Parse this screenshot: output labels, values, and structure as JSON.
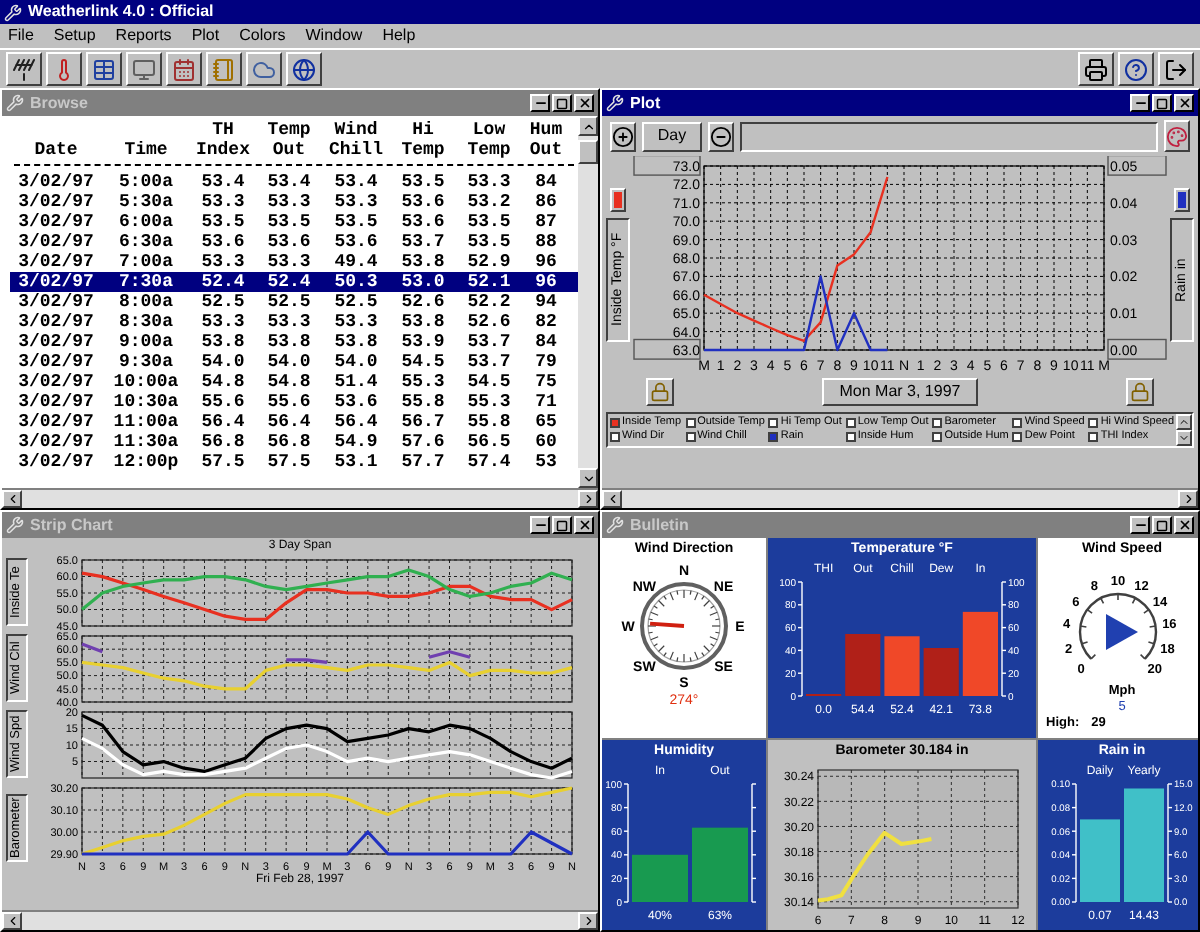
{
  "app": {
    "title": "Weatherlink 4.0 : Official",
    "menu": [
      "File",
      "Setup",
      "Reports",
      "Plot",
      "Colors",
      "Window",
      "Help"
    ]
  },
  "browse": {
    "title": "Browse",
    "active": false,
    "columns": [
      {
        "lines": [
          "Date"
        ]
      },
      {
        "lines": [
          "Time"
        ]
      },
      {
        "lines": [
          "TH",
          "Index"
        ]
      },
      {
        "lines": [
          "Temp",
          "Out"
        ]
      },
      {
        "lines": [
          "Wind",
          "Chill"
        ]
      },
      {
        "lines": [
          "Hi",
          "Temp"
        ]
      },
      {
        "lines": [
          "Low",
          "Temp"
        ]
      },
      {
        "lines": [
          "Hum",
          "Out"
        ]
      }
    ],
    "rows": [
      {
        "cells": [
          "3/02/97",
          "5:00a",
          "53.4",
          "53.4",
          "53.4",
          "53.5",
          "53.3",
          "84"
        ],
        "selected": false
      },
      {
        "cells": [
          "3/02/97",
          "5:30a",
          "53.3",
          "53.3",
          "53.3",
          "53.6",
          "53.2",
          "86"
        ],
        "selected": false
      },
      {
        "cells": [
          "3/02/97",
          "6:00a",
          "53.5",
          "53.5",
          "53.5",
          "53.6",
          "53.5",
          "87"
        ],
        "selected": false
      },
      {
        "cells": [
          "3/02/97",
          "6:30a",
          "53.6",
          "53.6",
          "53.6",
          "53.7",
          "53.5",
          "88"
        ],
        "selected": false
      },
      {
        "cells": [
          "3/02/97",
          "7:00a",
          "53.3",
          "53.3",
          "49.4",
          "53.8",
          "52.9",
          "96"
        ],
        "selected": false
      },
      {
        "cells": [
          "3/02/97",
          "7:30a",
          "52.4",
          "52.4",
          "50.3",
          "53.0",
          "52.1",
          "96"
        ],
        "selected": true
      },
      {
        "cells": [
          "3/02/97",
          "8:00a",
          "52.5",
          "52.5",
          "52.5",
          "52.6",
          "52.2",
          "94"
        ],
        "selected": false
      },
      {
        "cells": [
          "3/02/97",
          "8:30a",
          "53.3",
          "53.3",
          "53.3",
          "53.8",
          "52.6",
          "82"
        ],
        "selected": false
      },
      {
        "cells": [
          "3/02/97",
          "9:00a",
          "53.8",
          "53.8",
          "53.8",
          "53.9",
          "53.7",
          "84"
        ],
        "selected": false
      },
      {
        "cells": [
          "3/02/97",
          "9:30a",
          "54.0",
          "54.0",
          "54.0",
          "54.5",
          "53.7",
          "79"
        ],
        "selected": false
      },
      {
        "cells": [
          "3/02/97",
          "10:00a",
          "54.8",
          "54.8",
          "51.4",
          "55.3",
          "54.5",
          "75"
        ],
        "selected": false
      },
      {
        "cells": [
          "3/02/97",
          "10:30a",
          "55.6",
          "55.6",
          "53.6",
          "55.8",
          "55.3",
          "71"
        ],
        "selected": false
      },
      {
        "cells": [
          "3/02/97",
          "11:00a",
          "56.4",
          "56.4",
          "56.4",
          "56.7",
          "55.8",
          "65"
        ],
        "selected": false
      },
      {
        "cells": [
          "3/02/97",
          "11:30a",
          "56.8",
          "56.8",
          "54.9",
          "57.6",
          "56.5",
          "60"
        ],
        "selected": false
      },
      {
        "cells": [
          "3/02/97",
          "12:00p",
          "57.5",
          "57.5",
          "53.1",
          "57.7",
          "57.4",
          "53"
        ],
        "selected": false
      }
    ]
  },
  "plot": {
    "title": "Plot",
    "active": true,
    "span": "Day",
    "left_axis_label": "Inside Temp °F",
    "right_axis_label": "Rain in",
    "date": "Mon Mar 3, 1997",
    "chart_data": {
      "type": "line",
      "grid": true,
      "categories": [
        "M",
        "1",
        "2",
        "3",
        "4",
        "5",
        "6",
        "7",
        "8",
        "9",
        "10",
        "11",
        "N",
        "1",
        "2",
        "3",
        "4",
        "5",
        "6",
        "7",
        "8",
        "9",
        "10",
        "11",
        "M"
      ],
      "series": [
        {
          "color": "#e83020",
          "values": [
            66.0,
            65.5,
            65.0,
            64.6,
            64.2,
            63.8,
            63.5,
            64.5,
            67.6,
            68.2,
            69.4,
            72.4,
            null,
            null,
            null,
            null,
            null,
            null,
            null,
            null,
            null,
            null,
            null,
            null,
            null
          ]
        },
        {
          "color": "#2030c0",
          "axis": "y2",
          "values": [
            0,
            0,
            0,
            0,
            0,
            0,
            0,
            0.02,
            0,
            0.01,
            0,
            0,
            null,
            null,
            null,
            null,
            null,
            null,
            null,
            null,
            null,
            null,
            null,
            null,
            null
          ]
        }
      ],
      "ylim": [
        63,
        73
      ],
      "yticks": [
        {
          "value": 63,
          "label": "63.0"
        },
        {
          "value": 64,
          "label": "64.0"
        },
        {
          "value": 65,
          "label": "65.0"
        },
        {
          "value": 66,
          "label": "66.0"
        },
        {
          "value": 67,
          "label": "67.0"
        },
        {
          "value": 68,
          "label": "68.0"
        },
        {
          "value": 69,
          "label": "69.0"
        },
        {
          "value": 70,
          "label": "70.0"
        },
        {
          "value": 71,
          "label": "71.0"
        },
        {
          "value": 72,
          "label": "72.0"
        },
        {
          "value": 73,
          "label": "73.0"
        }
      ],
      "y2lim": [
        0,
        0.05
      ],
      "y2ticks": [
        {
          "value": 0,
          "label": "0.00"
        },
        {
          "value": 0.01,
          "label": "0.01"
        },
        {
          "value": 0.02,
          "label": "0.02"
        },
        {
          "value": 0.03,
          "label": "0.03"
        },
        {
          "value": 0.04,
          "label": "0.04"
        },
        {
          "value": 0.05,
          "label": "0.05"
        }
      ]
    },
    "legend": [
      {
        "label": "Inside Temp",
        "checked": true,
        "color": "#e83020"
      },
      {
        "label": "Outside Temp",
        "checked": false
      },
      {
        "label": "Hi Temp Out",
        "checked": false
      },
      {
        "label": "Low Temp Out",
        "checked": false
      },
      {
        "label": "Barometer",
        "checked": false
      },
      {
        "label": "Wind Speed",
        "checked": false
      },
      {
        "label": "Hi Wind Speed",
        "checked": false
      },
      {
        "label": "Wind Dir",
        "checked": false
      },
      {
        "label": "Wind Chill",
        "checked": false
      },
      {
        "label": "Rain",
        "checked": true,
        "color": "#2030c0"
      },
      {
        "label": "Inside Hum",
        "checked": false
      },
      {
        "label": "Outside Hum",
        "checked": false
      },
      {
        "label": "Dew Point",
        "checked": false
      },
      {
        "label": "THI Index",
        "checked": false
      }
    ]
  },
  "strip_chart": {
    "title": "Strip Chart",
    "active": false,
    "heading": "3 Day Span",
    "date": "Fri Feb 28, 1997",
    "panels": [
      {
        "label": "Inside Te",
        "chart_data": {
          "type": "line",
          "grid": true,
          "ylim": [
            45,
            65
          ],
          "yticks": [
            {
              "value": 45,
              "label": "45.0"
            },
            {
              "value": 50,
              "label": "50.0"
            },
            {
              "value": 55,
              "label": "55.0"
            },
            {
              "value": 60,
              "label": "60.0"
            },
            {
              "value": 65,
              "label": "65.0"
            }
          ],
          "series": [
            {
              "color": "#e83020",
              "values": [
                61,
                60,
                58,
                56,
                54,
                52,
                50,
                48,
                47,
                47,
                52,
                56,
                56,
                55,
                55,
                54,
                54,
                55,
                57,
                57,
                54,
                53,
                53,
                50,
                53
              ]
            },
            {
              "color": "#30b050",
              "values": [
                50,
                55,
                57,
                58,
                59,
                59,
                60,
                60,
                59,
                57,
                56,
                57,
                58,
                59,
                60,
                60,
                62,
                60,
                56,
                54,
                55,
                57,
                58,
                61,
                59
              ]
            }
          ]
        }
      },
      {
        "label": "Wind Chl",
        "chart_data": {
          "type": "line",
          "grid": true,
          "ylim": [
            40,
            65
          ],
          "yticks": [
            {
              "value": 40,
              "label": "40.0"
            },
            {
              "value": 45,
              "label": "45.0"
            },
            {
              "value": 50,
              "label": "50.0"
            },
            {
              "value": 55,
              "label": "55.0"
            },
            {
              "value": 60,
              "label": "60.0"
            },
            {
              "value": 65,
              "label": "65.0"
            }
          ],
          "series": [
            {
              "color": "#e8d030",
              "values": [
                55,
                54,
                53,
                51,
                49,
                48,
                46,
                45,
                45,
                52,
                54,
                54,
                53,
                52,
                54,
                54,
                53,
                52,
                55,
                50,
                52,
                52,
                51,
                51,
                53
              ]
            },
            {
              "color": "#7040b0",
              "values": [
                62,
                59,
                null,
                null,
                null,
                null,
                null,
                null,
                null,
                null,
                56,
                56,
                55,
                null,
                null,
                null,
                null,
                57,
                59,
                57,
                null,
                null,
                null,
                null,
                null
              ]
            }
          ]
        }
      },
      {
        "label": "Wind Spd",
        "chart_data": {
          "type": "line",
          "grid": true,
          "ylim": [
            0,
            20
          ],
          "yticks": [
            {
              "value": 5,
              "label": "5"
            },
            {
              "value": 10,
              "label": "10"
            },
            {
              "value": 15,
              "label": "15"
            },
            {
              "value": 20,
              "label": "20"
            }
          ],
          "series": [
            {
              "color": "#000000",
              "values": [
                19,
                16,
                8,
                4,
                5,
                3,
                2,
                4,
                6,
                12,
                15,
                16,
                15,
                11,
                12,
                13,
                15,
                14,
                16,
                15,
                12,
                8,
                5,
                3,
                6
              ]
            },
            {
              "color": "#ffffff",
              "values": [
                12,
                9,
                4,
                1,
                2,
                1,
                1,
                2,
                3,
                6,
                9,
                10,
                8,
                5,
                6,
                5,
                6,
                7,
                8,
                7,
                5,
                3,
                1,
                0,
                2
              ]
            }
          ]
        }
      },
      {
        "label": "Barometer",
        "chart_data": {
          "type": "line",
          "grid": true,
          "ylim": [
            29.9,
            30.2
          ],
          "yticks": [
            {
              "value": 29.9,
              "label": "29.90"
            },
            {
              "value": 30.0,
              "label": "30.00"
            },
            {
              "value": 30.1,
              "label": "30.10"
            },
            {
              "value": 30.2,
              "label": "30.20"
            }
          ],
          "categories": [
            "N",
            "3",
            "6",
            "9",
            "M",
            "3",
            "6",
            "9",
            "N",
            "3",
            "6",
            "9",
            "M",
            "3",
            "6",
            "9",
            "N",
            "3",
            "6",
            "9",
            "M",
            "3",
            "6",
            "9",
            "N"
          ],
          "series": [
            {
              "color": "#e8d030",
              "values": [
                29.9,
                29.93,
                29.96,
                29.98,
                29.99,
                30.03,
                30.08,
                30.13,
                30.17,
                30.17,
                30.17,
                30.17,
                30.17,
                30.15,
                30.11,
                30.08,
                30.12,
                30.15,
                30.17,
                30.17,
                30.18,
                30.18,
                30.16,
                30.18,
                30.2
              ]
            },
            {
              "color": "#2030c0",
              "values": [
                29.9,
                29.9,
                29.9,
                29.9,
                29.9,
                29.9,
                29.9,
                29.9,
                29.9,
                29.9,
                29.9,
                29.9,
                29.9,
                29.9,
                30.0,
                29.9,
                29.9,
                29.9,
                29.9,
                29.9,
                29.9,
                29.9,
                30.0,
                29.95,
                29.9
              ]
            }
          ]
        }
      }
    ]
  },
  "bulletin": {
    "title": "Bulletin",
    "active": false,
    "wind_direction": {
      "title": "Wind Direction",
      "points": [
        "N",
        "NE",
        "E",
        "SE",
        "S",
        "SW",
        "W",
        "NW"
      ],
      "reading": "274°"
    },
    "temperature": {
      "chart_data": {
        "type": "bar",
        "title": "Temperature °F",
        "categories": [
          "THI",
          "Out",
          "Chill",
          "Dew",
          "In"
        ],
        "series": [
          {
            "color": "#b02018",
            "values": [
              0.0,
              54.4,
              null,
              42.1,
              null
            ]
          },
          {
            "color": "#f04828",
            "values": [
              null,
              null,
              52.4,
              null,
              73.8
            ]
          }
        ],
        "ylim": [
          0,
          100
        ],
        "yticks": [
          {
            "value": 0,
            "label": "0"
          },
          {
            "value": 20,
            "label": "20"
          },
          {
            "value": 40,
            "label": "40"
          },
          {
            "value": 60,
            "label": "60"
          },
          {
            "value": 80,
            "label": "80"
          },
          {
            "value": 100,
            "label": "100"
          }
        ],
        "y2lim": [
          0,
          100
        ],
        "y2ticks": [
          {
            "value": 0,
            "label": "0"
          },
          {
            "value": 20,
            "label": "20"
          },
          {
            "value": 40,
            "label": "40"
          },
          {
            "value": 60,
            "label": "60"
          },
          {
            "value": 80,
            "label": "80"
          },
          {
            "value": 100,
            "label": "100"
          }
        ],
        "value_labels": [
          "0.0",
          "54.4",
          "52.4",
          "42.1",
          "73.8"
        ]
      }
    },
    "wind_speed": {
      "title": "Wind Speed",
      "dial": [
        "0",
        "2",
        "4",
        "6",
        "8",
        "10",
        "12",
        "14",
        "16",
        "18",
        "20"
      ],
      "unit": "Mph",
      "reading": "5",
      "high_label": "High:",
      "high": "29"
    },
    "humidity": {
      "chart_data": {
        "type": "bar",
        "title": "Humidity",
        "categories": [
          "In",
          "Out"
        ],
        "series": [
          {
            "color": "#189a50",
            "values": [
              40,
              63
            ]
          }
        ],
        "ylim": [
          0,
          100
        ],
        "yticks": [
          {
            "value": 0,
            "label": "0"
          },
          {
            "value": 20,
            "label": "20"
          },
          {
            "value": 40,
            "label": "40"
          },
          {
            "value": 60,
            "label": "60"
          },
          {
            "value": 80,
            "label": "80"
          },
          {
            "value": 100,
            "label": "100"
          }
        ],
        "value_labels": [
          "40%",
          "63%"
        ]
      }
    },
    "barometer": {
      "chart_data": {
        "type": "line",
        "title": "Barometer 30.184 in",
        "grid": true,
        "x": [
          6,
          6.3,
          6.7,
          7,
          7.5,
          8,
          8.5,
          9,
          9.4
        ],
        "xlim": [
          6,
          12
        ],
        "xticks": [
          6,
          7,
          8,
          9,
          10,
          11,
          12
        ],
        "ylim": [
          30.135,
          30.245
        ],
        "yticks": [
          {
            "value": 30.14,
            "label": "30.14"
          },
          {
            "value": 30.16,
            "label": "30.16"
          },
          {
            "value": 30.18,
            "label": "30.18"
          },
          {
            "value": 30.2,
            "label": "30.20"
          },
          {
            "value": 30.22,
            "label": "30.22"
          },
          {
            "value": 30.24,
            "label": "30.24"
          }
        ],
        "series": [
          {
            "color": "#f0e040",
            "values": [
              30.141,
              30.142,
              30.145,
              30.158,
              30.178,
              30.195,
              30.186,
              30.188,
              30.19
            ]
          }
        ]
      }
    },
    "rain": {
      "chart_data": {
        "type": "bar",
        "title": "Rain in",
        "categories": [
          "Daily",
          "Yearly"
        ],
        "series": [
          {
            "color": "#40c0c8",
            "values": [
              0.07,
              null
            ]
          },
          {
            "color": "#40c0c8",
            "axis": "y2",
            "values": [
              null,
              14.43
            ]
          }
        ],
        "ylim": [
          0,
          0.1
        ],
        "yticks": [
          {
            "value": 0,
            "label": "0.00"
          },
          {
            "value": 0.02,
            "label": "0.02"
          },
          {
            "value": 0.04,
            "label": "0.04"
          },
          {
            "value": 0.06,
            "label": "0.06"
          },
          {
            "value": 0.08,
            "label": "0.08"
          },
          {
            "value": 0.1,
            "label": "0.10"
          }
        ],
        "y2lim": [
          0,
          15
        ],
        "y2ticks": [
          {
            "value": 0,
            "label": "0.0"
          },
          {
            "value": 3,
            "label": "3.0"
          },
          {
            "value": 6,
            "label": "6.0"
          },
          {
            "value": 9,
            "label": "9.0"
          },
          {
            "value": 12,
            "label": "12.0"
          },
          {
            "value": 15,
            "label": "15.0"
          }
        ],
        "value_labels": [
          "0.07",
          "14.43"
        ]
      }
    }
  }
}
